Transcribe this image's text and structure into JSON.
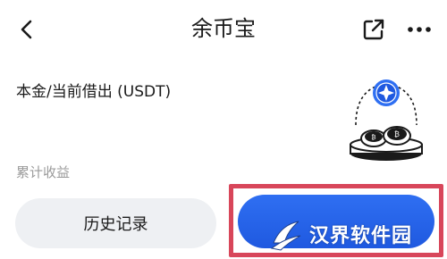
{
  "header": {
    "title": "余币宝",
    "back_icon": "chevron-left-icon",
    "share_icon": "share-out-icon",
    "more_icon": "more-dots-icon"
  },
  "content": {
    "principal_label": "本金/当前借出 (USDT)",
    "earnings_label": "累计收益",
    "illustration_icon": "coin-treasure-illustration"
  },
  "actions": {
    "history_label": "历史记录",
    "primary_label": ""
  },
  "watermark": {
    "text": "汉界软件园"
  },
  "colors": {
    "primary": "#2f6ff2",
    "highlight": "#d8465a",
    "secondary_bg": "#eef0f3",
    "muted_text": "#9a9a9a"
  }
}
